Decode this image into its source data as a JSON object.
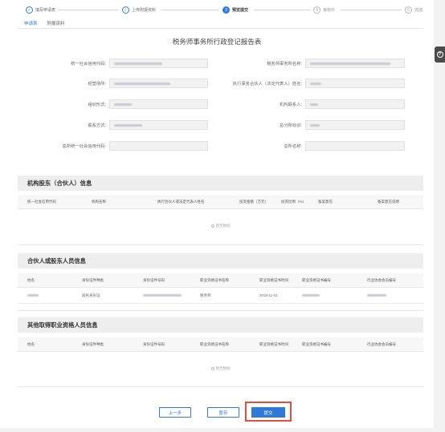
{
  "steps": [
    {
      "num": "✓",
      "label": "填写申请表",
      "state": "done"
    },
    {
      "num": "✓",
      "label": "上传附报资料",
      "state": "done"
    },
    {
      "num": "3",
      "label": "预览提交",
      "state": "active"
    },
    {
      "num": "4",
      "label": "审核中",
      "state": "todo"
    },
    {
      "num": "5",
      "label": "完成",
      "state": "todo"
    }
  ],
  "subtabs": [
    "申请表",
    "附报资料"
  ],
  "form": {
    "title": "税务师事务所行政登记报告表",
    "fields": {
      "credit_code": "统一社会信用代码:",
      "firm_name": "税务师事务所名称:",
      "address": "经营场所:",
      "partner": "执行事务合伙人（法定代表人）姓名:",
      "org_form": "组织形式:",
      "contact": "机构联系人:",
      "phone": "联系方式:",
      "hq_flag": "总分所标识:",
      "hq_credit_code": "总所统一社会信用代码:",
      "hq_name": "总所名称:"
    },
    "values": {
      "partner": "",
      "contact": "",
      "hq_flag": ""
    }
  },
  "section1": {
    "title": "机构股东（合伙人）信息",
    "columns": [
      "统一社会信用代码",
      "机构名称",
      "执行合伙人或法定代表人姓名",
      "投资金额（万元）",
      "投资比例（%）",
      "备案意见",
      "备案意见说明"
    ],
    "empty": "暂无数据"
  },
  "section2": {
    "title": "合伙人或股东人员信息",
    "columns": [
      "姓名",
      "身份证件种类",
      "身份证件号码",
      "职业资格证书名称",
      "职业资格证书时间",
      "职业资格证书编号",
      "行业协会会员编号"
    ],
    "rows": [
      {
        "name": "",
        "id_type": "居民身份证",
        "id_no": "",
        "cert_name": "税务师",
        "cert_date": "2018-11-01",
        "cert_no": "",
        "member_no": ""
      }
    ]
  },
  "section3": {
    "title": "其他取得职业资格人员信息",
    "columns": [
      "姓名",
      "身份证件种类",
      "身份证件号码",
      "职业资格证书名称",
      "职业资格证书时间",
      "职业资格证书编号",
      "行业协会会员编号"
    ],
    "empty": "暂无数据"
  },
  "buttons": {
    "prev": "上一步",
    "save": "暂存",
    "submit": "提交"
  },
  "help": {
    "label": "?"
  },
  "colors": {
    "primary": "#2f7ad7",
    "highlight": "#e74c3c"
  }
}
